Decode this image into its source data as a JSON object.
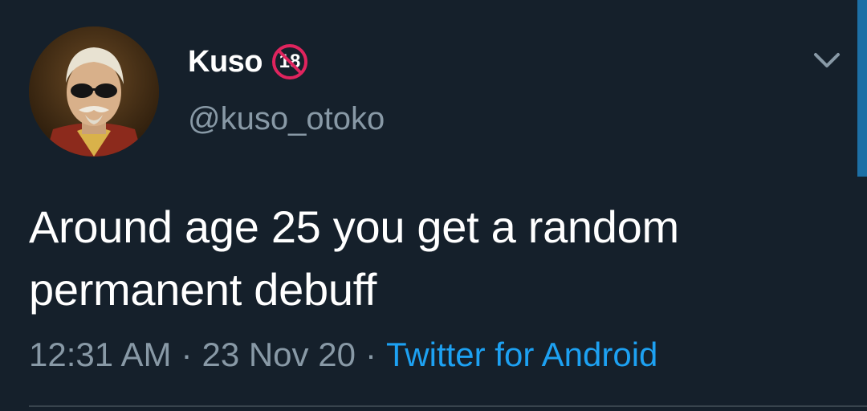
{
  "tweet": {
    "display_name": "Kuso",
    "badge_text": "18",
    "handle": "@kuso_otoko",
    "text_line1": "Around age 25 you get a random",
    "text_line2": "permanent debuff",
    "time": "12:31 AM",
    "separator": "·",
    "date": "23 Nov 20",
    "source": "Twitter for Android"
  },
  "colors": {
    "background": "#15202b",
    "secondary_text": "#8899a6",
    "link": "#1da1f2",
    "badge_red": "#e0245e"
  },
  "icons": {
    "avatar": "avatar-portrait-sunglasses-icon",
    "badge": "no-18-icon",
    "menu": "chevron-down-icon"
  }
}
